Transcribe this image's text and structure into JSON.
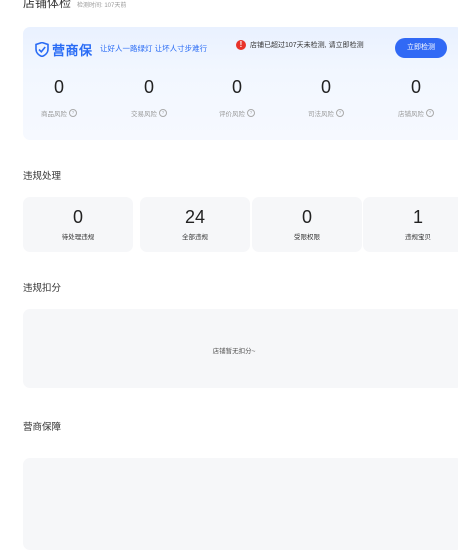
{
  "header": {
    "title": "店铺体检",
    "check_time": "检测时间: 107天前"
  },
  "banner": {
    "brand_name": "营商保",
    "slogan": "让好人一路绿灯 让坏人寸步难行",
    "warning": "店铺已超过107天未检测, 请立即检测",
    "check_button": "立即检测"
  },
  "risks": [
    {
      "value": "0",
      "label": "商品风险"
    },
    {
      "value": "0",
      "label": "交易风险"
    },
    {
      "value": "0",
      "label": "评价风险"
    },
    {
      "value": "0",
      "label": "司法风险"
    },
    {
      "value": "0",
      "label": "店铺风险"
    }
  ],
  "violations": {
    "title": "违规处理",
    "items": [
      {
        "value": "0",
        "label": "待处理违规"
      },
      {
        "value": "24",
        "label": "全部违规"
      },
      {
        "value": "0",
        "label": "受限权限"
      },
      {
        "value": "1",
        "label": "违规宝贝"
      }
    ]
  },
  "deduction": {
    "title": "违规扣分",
    "empty_text": "店铺暂无扣分~"
  },
  "guarantee": {
    "title": "营商保障"
  },
  "colors": {
    "accent": "#3169f5",
    "warning": "#e8332a",
    "panel_bg": "#f6f7f9"
  }
}
